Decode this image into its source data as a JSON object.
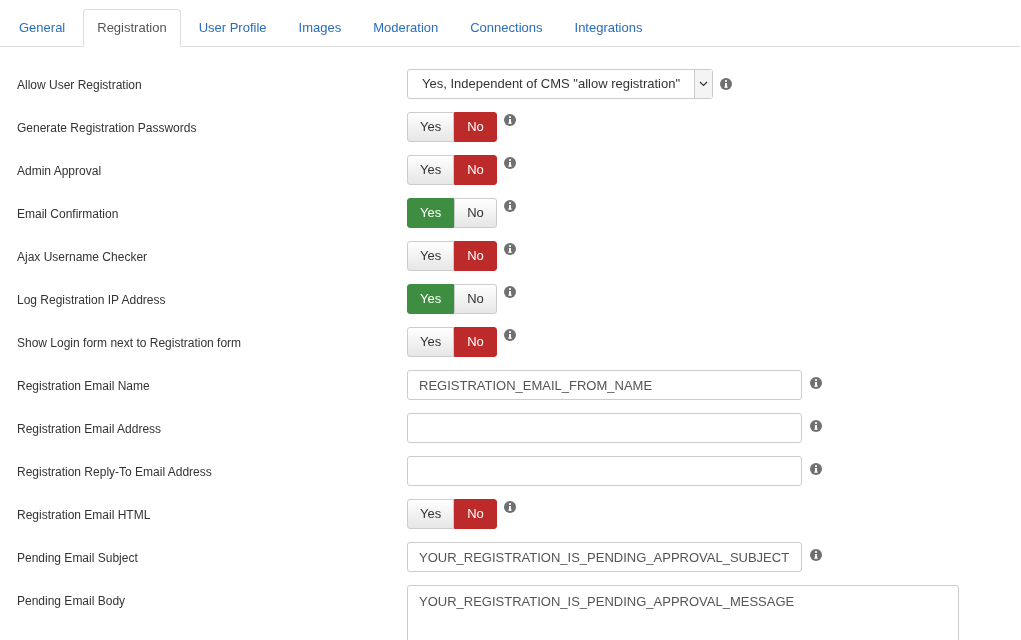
{
  "tabs": [
    {
      "label": "General",
      "selected": false
    },
    {
      "label": "Registration",
      "selected": true
    },
    {
      "label": "User Profile",
      "selected": false
    },
    {
      "label": "Images",
      "selected": false
    },
    {
      "label": "Moderation",
      "selected": false
    },
    {
      "label": "Connections",
      "selected": false
    },
    {
      "label": "Integrations",
      "selected": false
    }
  ],
  "fields": [
    {
      "kind": "select",
      "label": "Allow User Registration",
      "value": "Yes, Independent of CMS \"allow registration\""
    },
    {
      "kind": "toggle",
      "label": "Generate Registration Passwords",
      "options": [
        {
          "label": "Yes",
          "selected": false
        },
        {
          "label": "No",
          "selected": true
        }
      ]
    },
    {
      "kind": "toggle",
      "label": "Admin Approval",
      "options": [
        {
          "label": "Yes",
          "selected": false
        },
        {
          "label": "No",
          "selected": true
        }
      ]
    },
    {
      "kind": "toggle",
      "label": "Email Confirmation",
      "options": [
        {
          "label": "Yes",
          "selected": true
        },
        {
          "label": "No",
          "selected": false
        }
      ]
    },
    {
      "kind": "toggle",
      "label": "Ajax Username Checker",
      "options": [
        {
          "label": "Yes",
          "selected": false
        },
        {
          "label": "No",
          "selected": true
        }
      ]
    },
    {
      "kind": "toggle",
      "label": "Log Registration IP Address",
      "options": [
        {
          "label": "Yes",
          "selected": true
        },
        {
          "label": "No",
          "selected": false
        }
      ]
    },
    {
      "kind": "toggle",
      "label": "Show Login form next to Registration form",
      "options": [
        {
          "label": "Yes",
          "selected": false
        },
        {
          "label": "No",
          "selected": true
        }
      ]
    },
    {
      "kind": "text",
      "label": "Registration Email Name",
      "value": "REGISTRATION_EMAIL_FROM_NAME"
    },
    {
      "kind": "text",
      "label": "Registration Email Address"
    },
    {
      "kind": "text",
      "label": "Registration Reply-To Email Address"
    },
    {
      "kind": "toggle",
      "label": "Registration Email HTML",
      "options": [
        {
          "label": "Yes",
          "selected": false
        },
        {
          "label": "No",
          "selected": true
        }
      ]
    },
    {
      "kind": "text",
      "label": "Pending Email Subject",
      "value": "YOUR_REGISTRATION_IS_PENDING_APPROVAL_SUBJECT"
    },
    {
      "kind": "textarea",
      "label": "Pending Email Body",
      "value": "YOUR_REGISTRATION_IS_PENDING_APPROVAL_MESSAGE"
    }
  ]
}
